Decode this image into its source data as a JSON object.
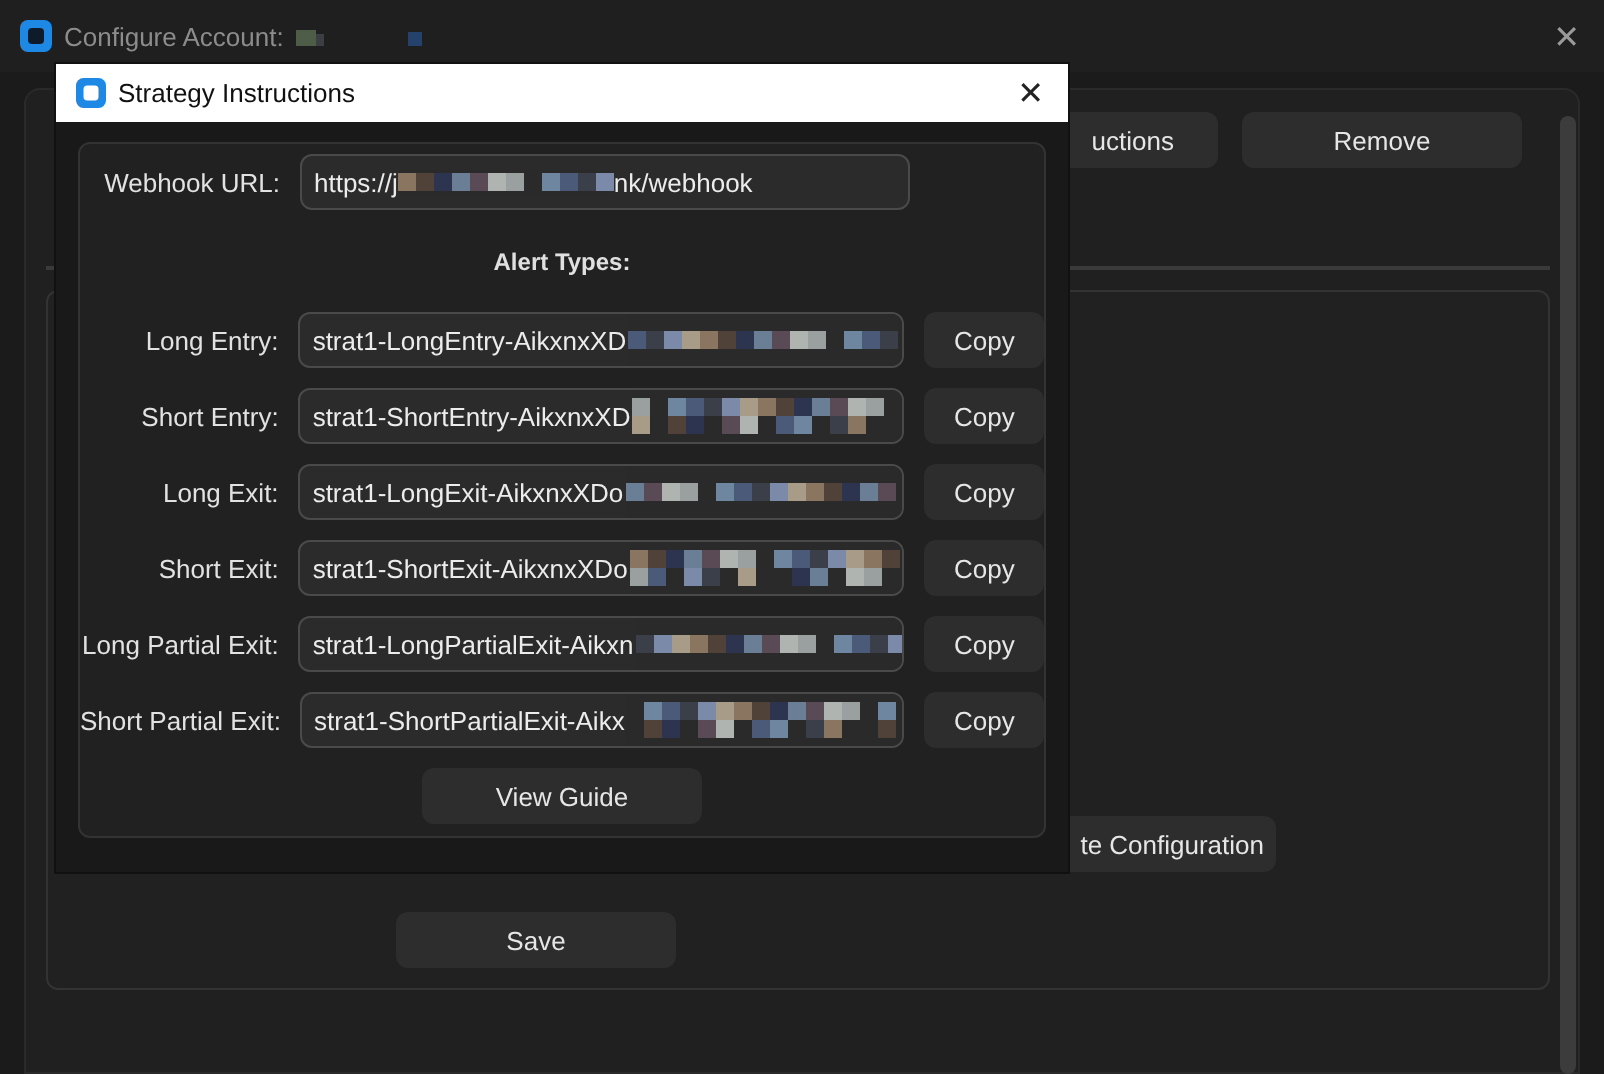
{
  "window": {
    "title": "Configure Account:",
    "close": "✕"
  },
  "top_buttons": [
    "uctions",
    "Remove"
  ],
  "panel_buttons": [
    "te Configuration"
  ],
  "save_button": "Save",
  "dialog": {
    "title": "Strategy Instructions",
    "close": "✕",
    "webhook": {
      "label": "Webhook URL:",
      "value_start": "https://j",
      "value_end": "nk/webhook"
    },
    "heading": "Alert Types:",
    "alerts": [
      {
        "label": "Long Entry:",
        "value": "strat1-LongEntry-AikxnxXD",
        "button": "Copy"
      },
      {
        "label": "Short Entry:",
        "value": "strat1-ShortEntry-AikxnxXD",
        "button": "Copy"
      },
      {
        "label": "Long Exit:",
        "value": "strat1-LongExit-AikxnxXDo",
        "button": "Copy"
      },
      {
        "label": "Short Exit:",
        "value": "strat1-ShortExit-AikxnxXDo",
        "button": "Copy"
      },
      {
        "label": "Long Partial Exit:",
        "value": "strat1-LongPartialExit-Aikxn",
        "button": "Copy"
      },
      {
        "label": "Short Partial Exit:",
        "value": "strat1-ShortPartialExit-Aikx",
        "button": "Copy"
      }
    ],
    "guide_button": "View Guide"
  }
}
